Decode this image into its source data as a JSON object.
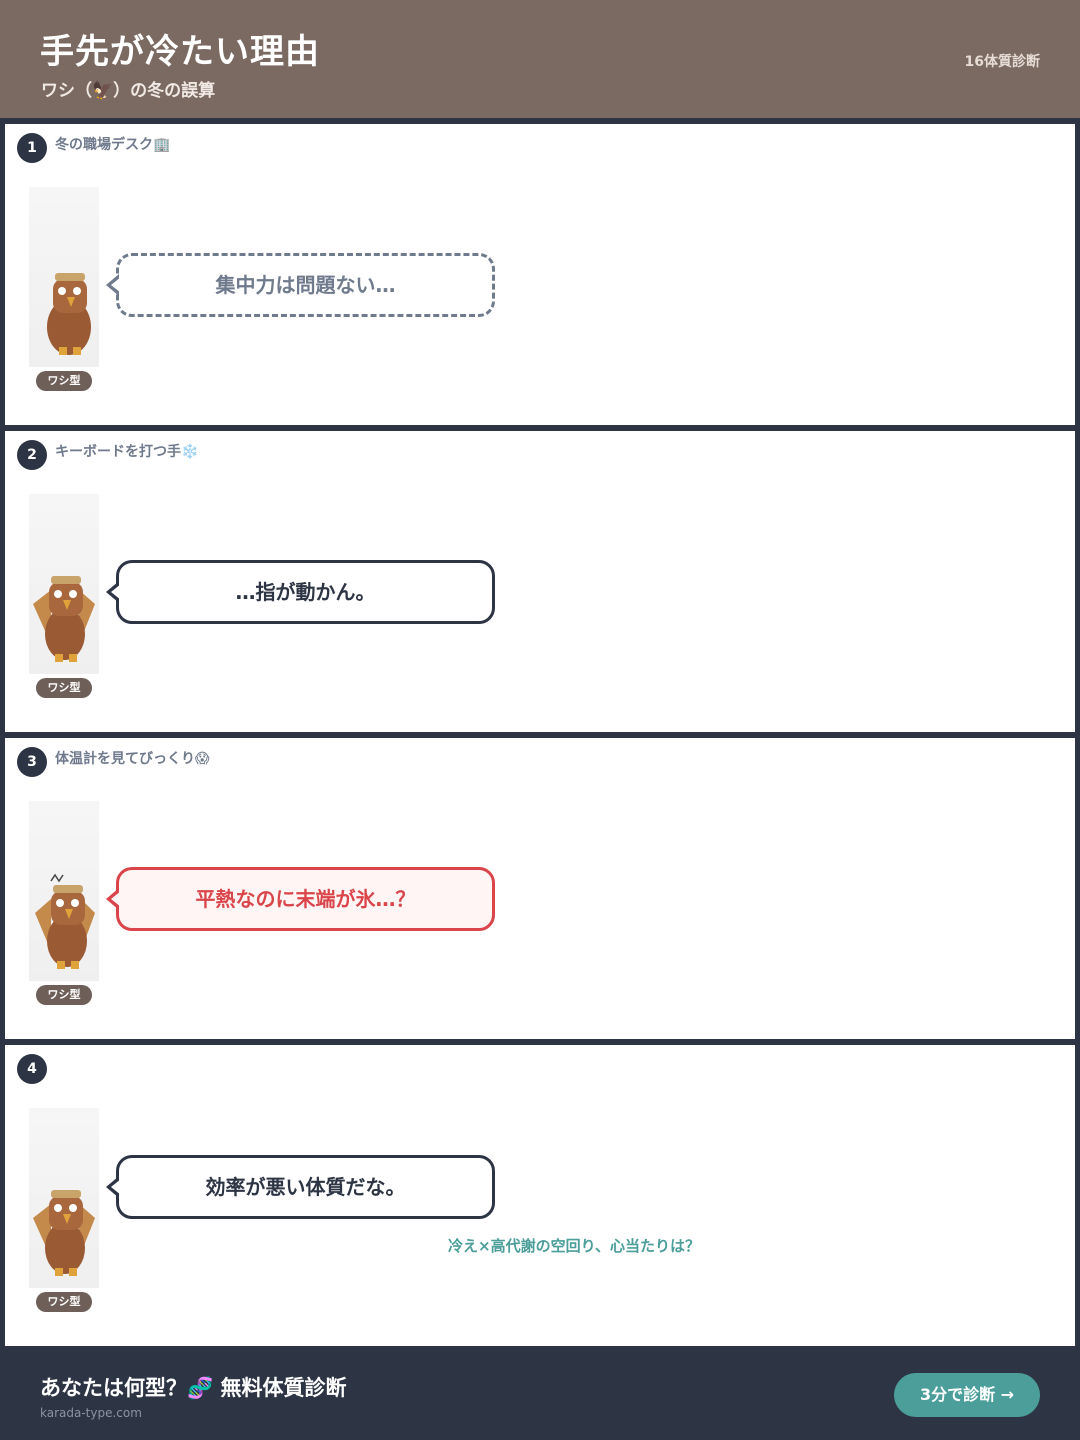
{
  "header": {
    "title": "手先が冷たい理由",
    "subtitle": "ワシ（🦅）の冬の誤算",
    "brand": "16体質診断"
  },
  "character_tag": "ワシ型",
  "panels": [
    {
      "number": "1",
      "caption": "冬の職場デスク🏢",
      "bubble": "集中力は問題ない…",
      "bubble_style": "dashed"
    },
    {
      "number": "2",
      "caption": "キーボードを打つ手❄️",
      "bubble": "…指が動かん。",
      "bubble_style": "normal"
    },
    {
      "number": "3",
      "caption": "体温計を見てびっくり😱",
      "bubble": "平熱なのに末端が氷…？",
      "bubble_style": "red"
    },
    {
      "number": "4",
      "caption": "",
      "bubble": "効率が悪い体質だな。",
      "bubble_style": "normal",
      "hook": "冷え×高代謝の空回り、心当たりは？"
    }
  ],
  "footer": {
    "cta_title": "あなたは何型？🧬 無料体質診断",
    "url": "karada-type.com",
    "button_label": "3分で診断 →"
  },
  "colors": {
    "header_bg": "#7b6a62",
    "dark": "#2d3544",
    "accent_teal": "#4b9e9a",
    "alert_red": "#d9454a"
  }
}
